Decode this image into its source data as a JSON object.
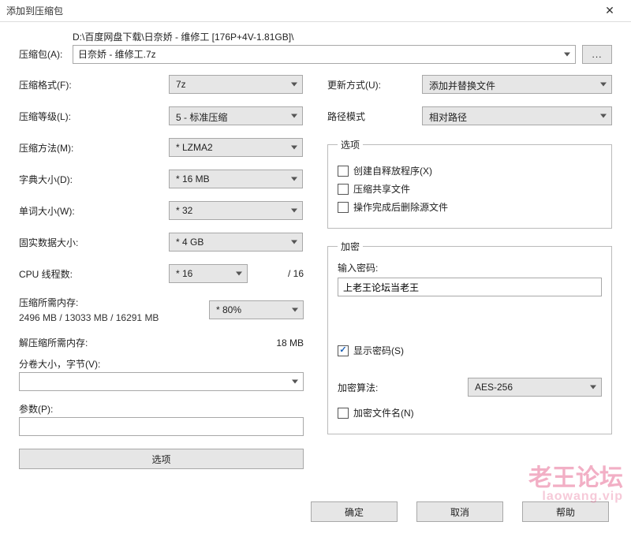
{
  "title": "添加到压缩包",
  "path": {
    "label": "压缩包(A):",
    "dir": "D:\\百度网盘下载\\日奈娇 - 维修工 [176P+4V-1.81GB]\\",
    "file": "日奈娇 - 维修工.7z",
    "browse": "..."
  },
  "left": {
    "format_label": "压缩格式(F):",
    "format_value": "7z",
    "level_label": "压缩等级(L):",
    "level_value": "5 - 标准压缩",
    "method_label": "压缩方法(M):",
    "method_value": "* LZMA2",
    "dict_label": "字典大小(D):",
    "dict_value": "* 16 MB",
    "word_label": "单词大小(W):",
    "word_value": "* 32",
    "solid_label": "固实数据大小:",
    "solid_value": "* 4 GB",
    "cpu_label": "CPU 线程数:",
    "cpu_value": "* 16",
    "cpu_total": "/ 16",
    "mem_comp_label": "压缩所需内存:",
    "mem_comp_value": "2496 MB / 13033 MB / 16291 MB",
    "mem_comp_drop": "* 80%",
    "mem_decomp_label": "解压缩所需内存:",
    "mem_decomp_value": "18 MB",
    "volume_label": "分卷大小，字节(V):",
    "params_label": "参数(P):",
    "options_btn": "选项"
  },
  "right": {
    "update_label": "更新方式(U):",
    "update_value": "添加并替换文件",
    "pathmode_label": "路径模式",
    "pathmode_value": "相对路径",
    "opts_legend": "选项",
    "opt_sfx": "创建自释放程序(X)",
    "opt_shared": "压缩共享文件",
    "opt_delete": "操作完成后删除源文件",
    "enc_legend": "加密",
    "enc_pass_label": "输入密码:",
    "enc_pass_value": "上老王论坛当老王",
    "enc_show": "显示密码(S)",
    "enc_algo_label": "加密算法:",
    "enc_algo_value": "AES-256",
    "enc_names": "加密文件名(N)"
  },
  "footer": {
    "ok": "确定",
    "cancel": "取消",
    "help": "帮助"
  },
  "watermark": {
    "line1": "老王论坛",
    "line2": "laowang.vip"
  }
}
